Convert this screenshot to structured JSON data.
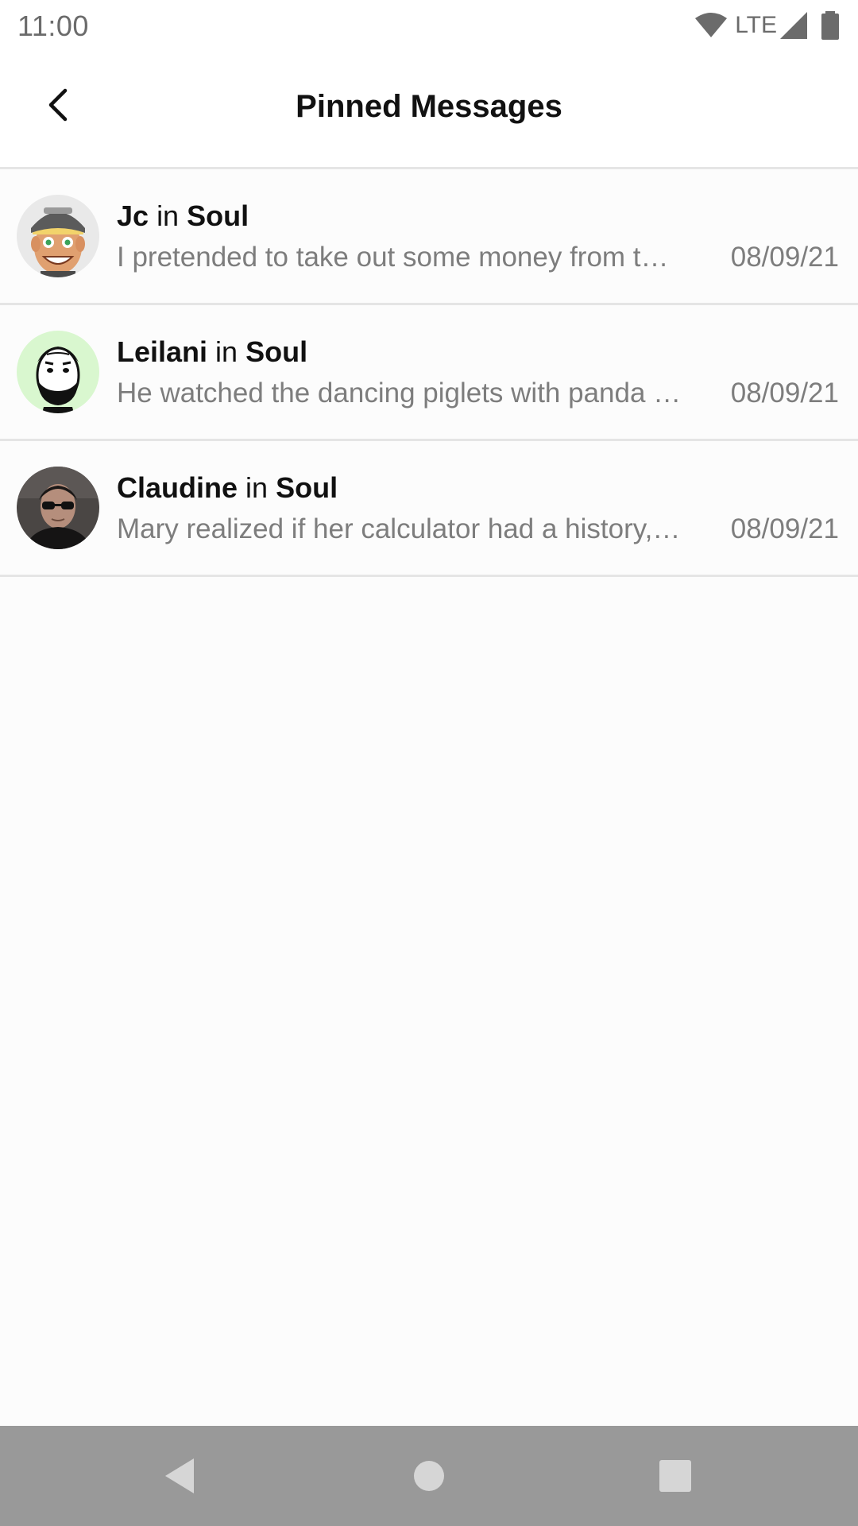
{
  "status_bar": {
    "time": "11:00",
    "network": "LTE",
    "icons": [
      "wifi-icon",
      "cell-signal-icon",
      "battery-icon"
    ]
  },
  "app_bar": {
    "title": "Pinned Messages",
    "back_icon": "back-arrow-icon"
  },
  "messages": [
    {
      "author": "Jc",
      "connector": "in",
      "channel": "Soul",
      "preview": "I pretended to take out some money from the cash machine",
      "date": "08/09/21",
      "avatar": "cartoon-face-cap"
    },
    {
      "author": "Leilani",
      "connector": "in",
      "channel": "Soul",
      "preview": "He watched the dancing piglets with panda bears",
      "date": "08/09/21",
      "avatar": "bearded-face-green"
    },
    {
      "author": "Claudine",
      "connector": "in",
      "channel": "Soul",
      "preview": "Mary realized if her calculator had a history, it would be more embarrassing than her browser history",
      "date": "08/09/21",
      "avatar": "photo-sunglasses"
    }
  ],
  "nav_bar": {
    "buttons": [
      "nav-back-icon",
      "nav-home-icon",
      "nav-recents-icon"
    ]
  },
  "colors": {
    "background": "#fcfcfc",
    "divider": "#e5e5e5",
    "secondary_text": "#7d7d7d",
    "nav_bar": "#999999"
  }
}
